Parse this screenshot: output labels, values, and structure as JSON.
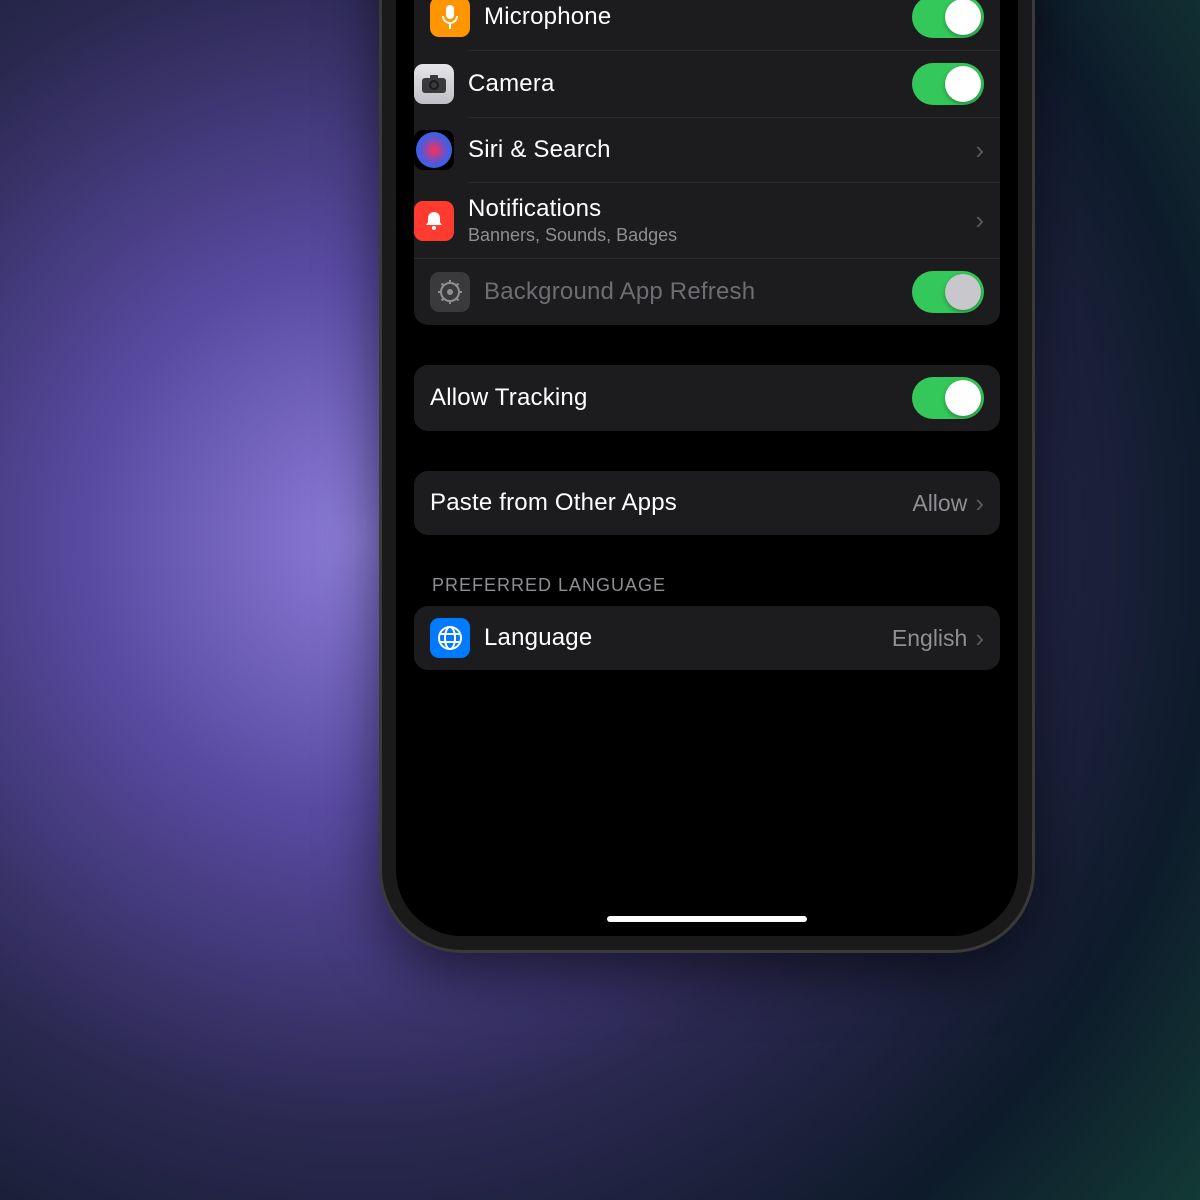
{
  "section1": {
    "microphone": {
      "label": "Microphone",
      "on": true
    },
    "camera": {
      "label": "Camera",
      "on": true
    },
    "siri": {
      "label": "Siri & Search"
    },
    "notifications": {
      "label": "Notifications",
      "sub": "Banners, Sounds, Badges"
    },
    "bgrefresh": {
      "label": "Background App Refresh",
      "on": true
    }
  },
  "tracking": {
    "label": "Allow Tracking",
    "on": true
  },
  "paste": {
    "label": "Paste from Other Apps",
    "value": "Allow"
  },
  "lang_header": "Preferred Language",
  "language": {
    "label": "Language",
    "value": "English"
  }
}
